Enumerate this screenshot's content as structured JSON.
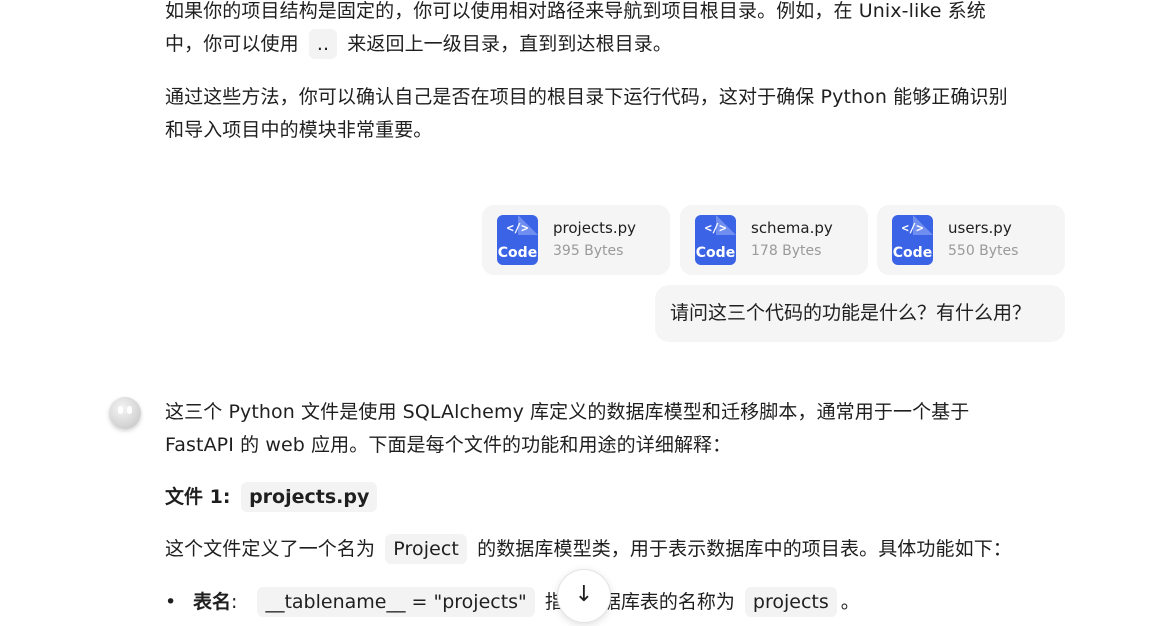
{
  "answer_prev": {
    "line1": "如果你的项目结构是固定的，你可以使用相对路径来导航到项目根目录。例如，在 Unix-like 系统",
    "line2_pre": "中，你可以使用",
    "line2_code": "..",
    "line2_post": "来返回上一级目录，直到到达根目录。",
    "p2_line1": "通过这些方法，你可以确认自己是否在项目的根目录下运行代码，这对于确保 Python 能够正确识别",
    "p2_line2": "和导入项目中的模块非常重要。"
  },
  "attachments": [
    {
      "name": "projects.py",
      "size": "395 Bytes",
      "icon_label": "Code",
      "icon_glyph": "</>"
    },
    {
      "name": "schema.py",
      "size": "178 Bytes",
      "icon_label": "Code",
      "icon_glyph": "</>"
    },
    {
      "name": "users.py",
      "size": "550 Bytes",
      "icon_label": "Code",
      "icon_glyph": "</>"
    }
  ],
  "user_message": "请问这三个代码的功能是什么？有什么用？",
  "answer": {
    "intro_line1": "这三个 Python 文件是使用 SQLAlchemy 库定义的数据库模型和迁移脚本，通常用于一个基于",
    "intro_line2": "FastAPI 的 web 应用。下面是每个文件的功能和用途的详细解释：",
    "heading_label": "文件 1:",
    "heading_code": "projects.py",
    "desc_pre": "这个文件定义了一个名为",
    "desc_code": "Project",
    "desc_post": "的数据库模型类，用于表示数据库中的项目表。具体功能如下：",
    "bullet_label": "表名",
    "bullet_colon": ":",
    "bullet_code": "__tablename__ = \"projects\"",
    "bullet_mid": "指定数据库表的名称为",
    "bullet_code2": "projects",
    "bullet_end": "。"
  },
  "scroll_button": {
    "icon": "arrow-down-icon",
    "glyph": "↓"
  },
  "colors": {
    "file_icon": "#3b63e6",
    "bubble_bg": "#f5f5f6",
    "code_bg": "#f3f3f4"
  }
}
